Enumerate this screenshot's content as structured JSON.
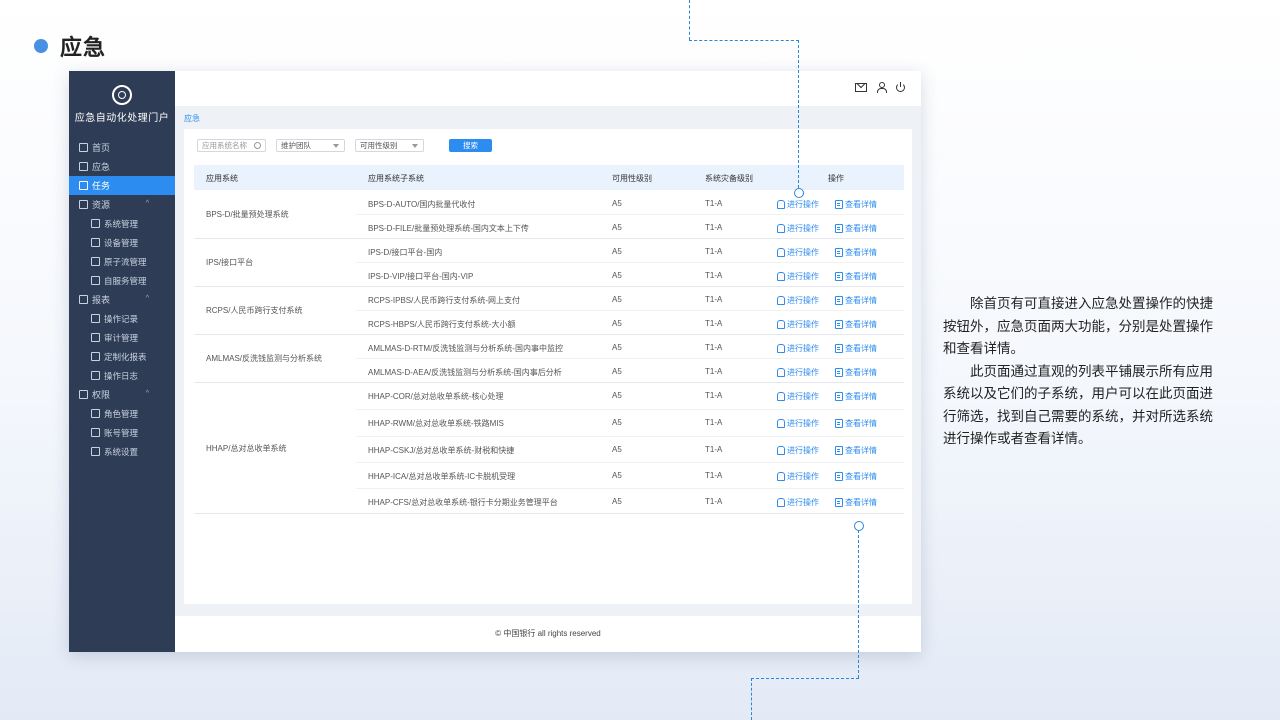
{
  "slide": {
    "title": "应急",
    "description": [
      "除首页有可直接进入应急处置操作的快捷按钮外，应急页面两大功能，分别是处置操作和查看详情。",
      "此页面通过直观的列表平铺展示所有应用系统以及它们的子系统，用户可以在此页面进行筛选，找到自己需要的系统，并对所选系统进行操作或者查看详情。"
    ]
  },
  "app": {
    "brand": "应急自动化处理门户",
    "breadcrumb": "应急",
    "footer": "© 中国银行 all rights reserved",
    "topbar_icons": [
      "mail-icon",
      "user-icon",
      "power-icon"
    ],
    "nav": [
      {
        "label": "首页",
        "level": 1,
        "icon": "home-icon"
      },
      {
        "label": "应急",
        "level": 1,
        "icon": "alert-icon"
      },
      {
        "label": "任务",
        "level": 1,
        "icon": "task-icon",
        "active": true
      },
      {
        "label": "资源",
        "level": 1,
        "icon": "resource-icon",
        "expanded": true
      },
      {
        "label": "系统管理",
        "level": 2,
        "icon": "system-icon"
      },
      {
        "label": "设备管理",
        "level": 2,
        "icon": "device-icon"
      },
      {
        "label": "原子流管理",
        "level": 2,
        "icon": "flow-icon"
      },
      {
        "label": "自服务管理",
        "level": 2,
        "icon": "service-icon"
      },
      {
        "label": "报表",
        "level": 1,
        "icon": "report-icon",
        "expanded": true
      },
      {
        "label": "操作记录",
        "level": 2,
        "icon": "record-icon"
      },
      {
        "label": "审计管理",
        "level": 2,
        "icon": "audit-icon"
      },
      {
        "label": "定制化报表",
        "level": 2,
        "icon": "custom-report-icon"
      },
      {
        "label": "操作日志",
        "level": 2,
        "icon": "log-icon"
      },
      {
        "label": "权限",
        "level": 1,
        "icon": "permission-icon",
        "expanded": true
      },
      {
        "label": "角色管理",
        "level": 2,
        "icon": "role-icon"
      },
      {
        "label": "账号管理",
        "level": 2,
        "icon": "account-icon"
      },
      {
        "label": "系统设置",
        "level": 2,
        "icon": "settings-icon"
      }
    ],
    "filters": {
      "search_placeholder": "应用系统名称",
      "team_select": "维护团队",
      "level_select": "可用性级别",
      "search_button": "搜索"
    },
    "table": {
      "headers": [
        "应用系统",
        "应用系统子系统",
        "可用性级别",
        "系统灾备级别",
        "操作"
      ],
      "action_operate": "进行操作",
      "action_detail": "查看详情",
      "groups": [
        {
          "system": "BPS-D/批量预处理系统",
          "rows": [
            {
              "subsystem": "BPS-D-AUTO/国内批量代收付",
              "availability": "A5",
              "dr": "T1-A"
            },
            {
              "subsystem": "BPS-D-FILE/批量预处理系统-国内文本上下传",
              "availability": "A5",
              "dr": "T1-A"
            }
          ]
        },
        {
          "system": "IPS/接口平台",
          "rows": [
            {
              "subsystem": "IPS-D/接口平台-国内",
              "availability": "A5",
              "dr": "T1-A"
            },
            {
              "subsystem": "IPS-D-VIP/接口平台-国内-VIP",
              "availability": "A5",
              "dr": "T1-A"
            }
          ]
        },
        {
          "system": "RCPS/人民币跨行支付系统",
          "rows": [
            {
              "subsystem": "RCPS-IPBS/人民币跨行支付系统-网上支付",
              "availability": "A5",
              "dr": "T1-A"
            },
            {
              "subsystem": "RCPS-HBPS/人民币跨行支付系统-大小额",
              "availability": "A5",
              "dr": "T1-A"
            }
          ]
        },
        {
          "system": "AMLMAS/反洗钱监测与分析系统",
          "rows": [
            {
              "subsystem": "AMLMAS-D-RTM/反洗钱监测与分析系统-国内事中监控",
              "availability": "A5",
              "dr": "T1-A"
            },
            {
              "subsystem": "AMLMAS-D-AEA/反洗钱监测与分析系统-国内事后分析",
              "availability": "A5",
              "dr": "T1-A"
            }
          ]
        },
        {
          "system": "HHAP/总对总收单系统",
          "rows": [
            {
              "subsystem": "HHAP-COR/总对总收单系统-核心处理",
              "availability": "A5",
              "dr": "T1-A"
            },
            {
              "subsystem": "HHAP-RWM/总对总收单系统-铁路MIS",
              "availability": "A5",
              "dr": "T1-A"
            },
            {
              "subsystem": "HHAP-CSKJ/总对总收单系统-财税和快捷",
              "availability": "A5",
              "dr": "T1-A"
            },
            {
              "subsystem": "HHAP-ICA/总对总收单系统-IC卡脱机受理",
              "availability": "A5",
              "dr": "T1-A"
            },
            {
              "subsystem": "HHAP-CFS/总对总收单系统-银行卡分期业务管理平台",
              "availability": "A5",
              "dr": "T1-A"
            }
          ]
        }
      ]
    }
  }
}
